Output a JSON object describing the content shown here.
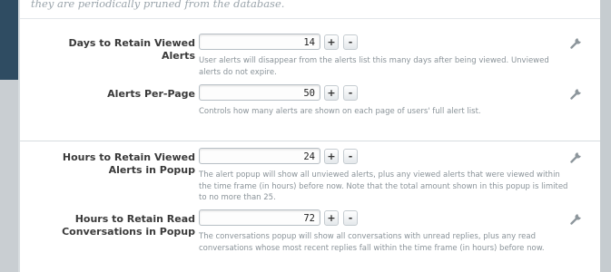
{
  "intro_text": "they are periodically pruned from the database.",
  "options": [
    {
      "label": "Days to Retain Viewed Alerts",
      "value": "14",
      "plus": "+",
      "minus": "-",
      "hint": "User alerts will disappear from the alerts list this many days after being viewed. Unviewed alerts do not expire."
    },
    {
      "label": "Alerts Per-Page",
      "value": "50",
      "plus": "+",
      "minus": "-",
      "hint": "Controls how many alerts are shown on each page of users' full alert list."
    },
    {
      "label": "Hours to Retain Viewed Alerts in Popup",
      "value": "24",
      "plus": "+",
      "minus": "-",
      "hint": "The alert popup will show all unviewed alerts, plus any viewed alerts that were viewed within the time frame (in hours) before now. Note that the total amount shown in this popup is limited to no more than 25."
    },
    {
      "label": "Hours to Retain Read Conversations in Popup",
      "value": "72",
      "plus": "+",
      "minus": "-",
      "hint": "The conversations popup will show all conversations with unread replies, plus any read conversations whose most recent replies fall within the time frame (in hours) before now."
    }
  ],
  "colors": {
    "header_bar": "#2f4c62",
    "label_text": "#3a3a3a",
    "hint_text": "#8a9399"
  },
  "icons": {
    "option_action": "wrench-icon"
  }
}
